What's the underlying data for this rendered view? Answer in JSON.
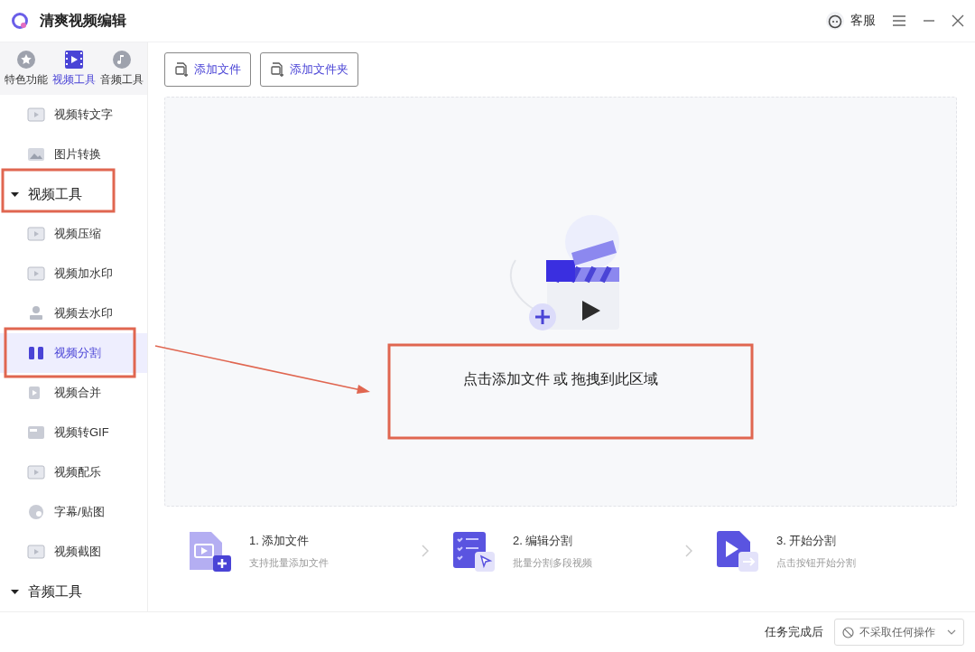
{
  "window": {
    "title": "清爽视频编辑",
    "service": "客服"
  },
  "sidebar": {
    "tabs": [
      {
        "label": "特色功能",
        "selected": false
      },
      {
        "label": "视频工具",
        "selected": true
      },
      {
        "label": "音频工具",
        "selected": false
      }
    ],
    "items": [
      {
        "kind": "item",
        "label": "视频转文字",
        "selected": false
      },
      {
        "kind": "item",
        "label": "图片转换",
        "selected": false
      },
      {
        "kind": "group",
        "label": "视频工具",
        "expanded": true,
        "children": [
          {
            "label": "视频压缩",
            "selected": false
          },
          {
            "label": "视频加水印",
            "selected": false
          },
          {
            "label": "视频去水印",
            "selected": false
          },
          {
            "label": "视频分割",
            "selected": true
          },
          {
            "label": "视频合并",
            "selected": false
          },
          {
            "label": "视频转GIF",
            "selected": false
          },
          {
            "label": "视频配乐",
            "selected": false
          },
          {
            "label": "字幕/贴图",
            "selected": false
          },
          {
            "label": "视频截图",
            "selected": false
          }
        ]
      },
      {
        "kind": "group",
        "label": "音频工具",
        "expanded": true
      }
    ]
  },
  "toolbar": {
    "buttons": [
      "添加文件",
      "添加文件夹"
    ]
  },
  "drop_zone": {
    "text": "点击添加文件 或 拖拽到此区域"
  },
  "steps": [
    {
      "title": "1. 添加文件",
      "subtitle": "支持批量添加文件"
    },
    {
      "title": "2. 编辑分割",
      "subtitle": "批量分割多段视频"
    },
    {
      "title": "3. 开始分割",
      "subtitle": "点击按钮开始分割"
    }
  ],
  "footer": {
    "label": "任务完成后",
    "dropdown_value": "不采取任何操作"
  }
}
